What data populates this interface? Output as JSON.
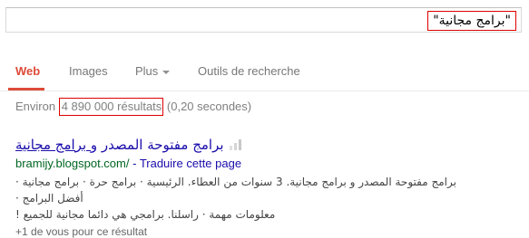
{
  "search": {
    "query": "\"برامج مجانية\""
  },
  "tabs": {
    "items": [
      "Web",
      "Images",
      "Plus",
      "Outils de recherche"
    ],
    "active": "Web"
  },
  "stats": {
    "prefix": "Environ ",
    "count": "4 890 000 résultats",
    "time": " (0,20 secondes)"
  },
  "result": {
    "title_part1": "برامج مفتوحة المصدر و",
    "title_part2": " برامج مجانية",
    "url": "bramijy.blogspot.com/",
    "translate_sep": " - ",
    "translate_label": "Traduire cette page",
    "snippet_line1": "برامج مفتوحة المصدر و برامج مجانية. 3 سنوات من العطاء. الرئيسية · برامج حرة · برامج مجانية · أفضل البرامج ·",
    "snippet_line2": "معلومات مهمة · راسلنا. برامجي هي دائما مجانية للجميع !",
    "plus_one": "+1 de vous pour ce résultat"
  },
  "colors": {
    "accent": "#dd4b39",
    "highlight_box": "#dd0000",
    "link": "#1a0dab",
    "url": "#006621"
  }
}
